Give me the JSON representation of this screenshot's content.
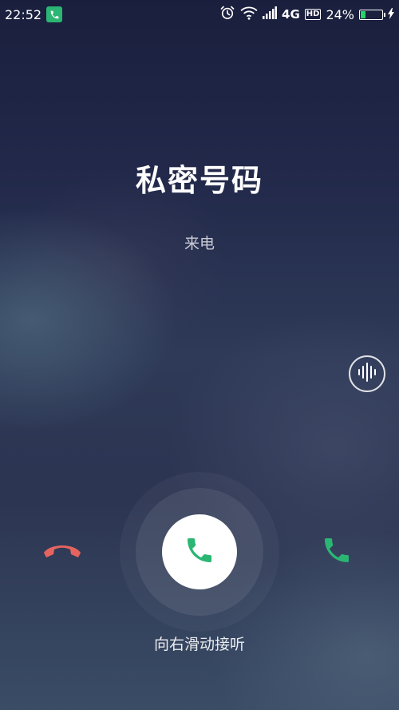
{
  "status_bar": {
    "time": "22:52",
    "network": "4G",
    "hd": "HD",
    "battery_percent": "24%",
    "battery_level": 0.24,
    "icons": [
      "phone-notification-icon",
      "alarm-icon",
      "wifi-icon",
      "signal-icon",
      "battery-icon",
      "charging-icon"
    ]
  },
  "call": {
    "caller_name": "私密号码",
    "status": "来电",
    "hint": "向右滑动接听"
  },
  "colors": {
    "accept": "#2bb673",
    "decline": "#e5645f",
    "battery_fill": "#2bd36b"
  },
  "icons": {
    "voice": "voice-waveform-icon",
    "decline": "hang-up-icon",
    "answer_handle": "phone-icon",
    "accept": "phone-icon"
  }
}
